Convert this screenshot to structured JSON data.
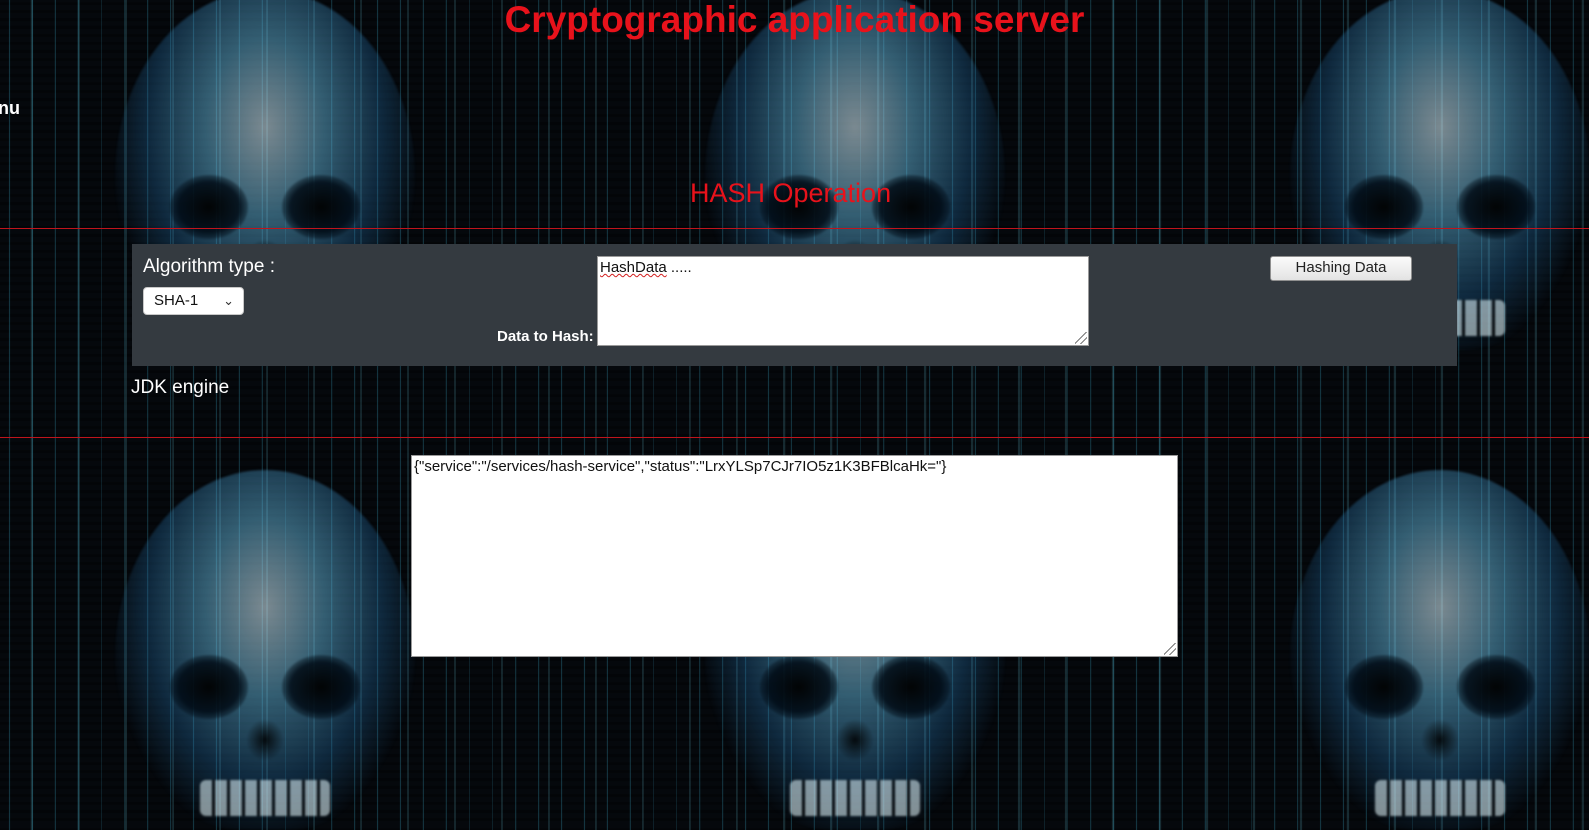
{
  "header": {
    "title": "Cryptographic application server",
    "side_fragment": "nu"
  },
  "section": {
    "title": "HASH Operation"
  },
  "form": {
    "algorithm_label": "Algorithm type :",
    "algorithm_selected": "SHA-1",
    "data_label": "Data to Hash:",
    "data_value_word": "HashData",
    "data_value_rest": " .....",
    "submit_label": "Hashing Data"
  },
  "engine": {
    "label": "JDK engine"
  },
  "result": {
    "text": "{\"service\":\"/services/hash-service\",\"status\":\"LrxYLSp7CJr7IO5z1K3BFBlcaHk=\"}"
  },
  "colors": {
    "title_red": "#e8121b",
    "panel_bg": "#343a40",
    "rule_red": "#c0141c"
  },
  "icons": {
    "select_chevron": "chevron-down-icon",
    "resize_grip": "resize-grip-icon"
  }
}
